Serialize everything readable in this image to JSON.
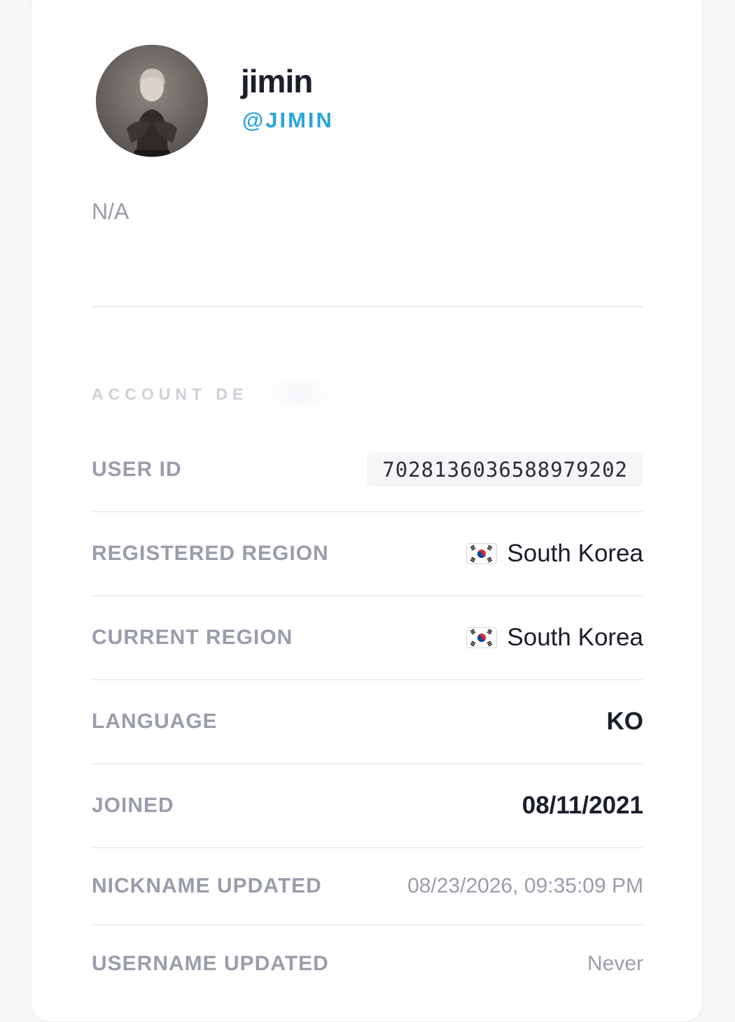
{
  "profile": {
    "display_name": "jimin",
    "handle": "@JIMIN",
    "bio": "N/A"
  },
  "account_details": {
    "section_title": "ACCOUNT DE",
    "rows": [
      {
        "label": "USER ID",
        "value": "7028136036588979202"
      },
      {
        "label": "REGISTERED REGION",
        "value": "South Korea",
        "flag_icon": "south-korea-flag-icon"
      },
      {
        "label": "CURRENT REGION",
        "value": "South Korea",
        "flag_icon": "south-korea-flag-icon"
      },
      {
        "label": "LANGUAGE",
        "value": "KO"
      },
      {
        "label": "JOINED",
        "value": "08/11/2021"
      },
      {
        "label": "NICKNAME UPDATED",
        "value": "08/23/2026, 09:35:09 PM"
      },
      {
        "label": "USERNAME UPDATED",
        "value": "Never"
      }
    ]
  },
  "colors": {
    "handle": "#2aa4de",
    "label": "#9a9daa",
    "value": "#1b1e2b"
  }
}
